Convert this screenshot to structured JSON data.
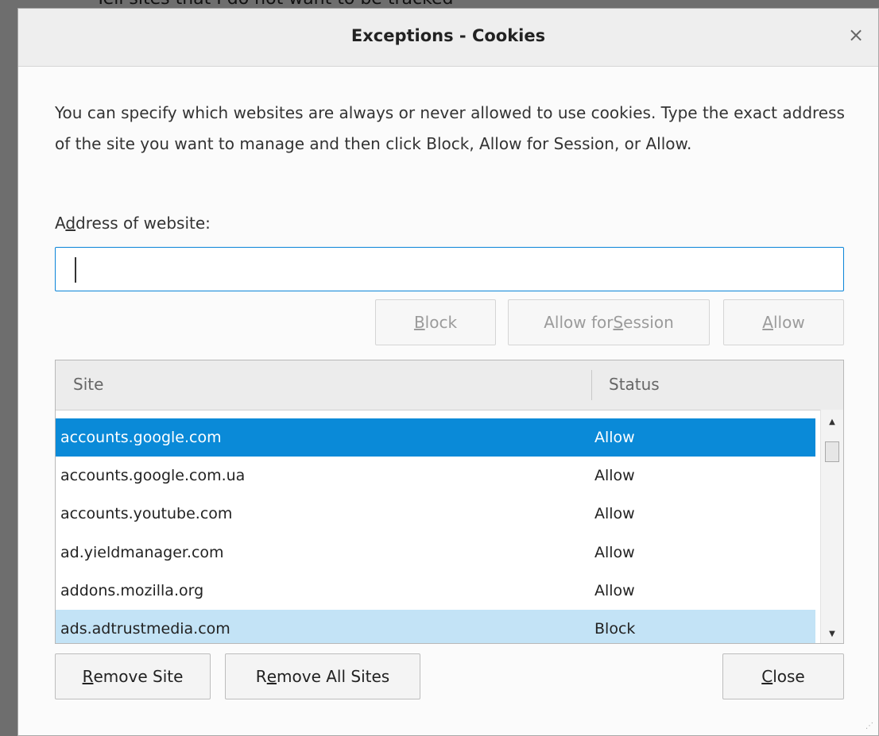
{
  "background_text": "• Tell sites that I do not want to be tracked",
  "dialog": {
    "title": "Exceptions - Cookies",
    "close_glyph": "×",
    "description": "You can specify which websites are always or never allowed to use cookies. Type the exact address of the site you want to manage and then click Block, Allow for Session, or Allow.",
    "address_label_pre": "A",
    "address_label_u": "d",
    "address_label_post": "dress of website:",
    "address_value": "",
    "buttons": {
      "block": {
        "pre": "",
        "u": "B",
        "post": "lock"
      },
      "allow_session": {
        "pre": "Allow for ",
        "u": "S",
        "post": "ession"
      },
      "allow": {
        "pre": "",
        "u": "A",
        "post": "llow"
      }
    },
    "table": {
      "headers": {
        "site": "Site",
        "status": "Status"
      },
      "rows": [
        {
          "site": "accounts.google.com",
          "status": "Allow"
        },
        {
          "site": "accounts.google.com.ua",
          "status": "Allow"
        },
        {
          "site": "accounts.youtube.com",
          "status": "Allow"
        },
        {
          "site": "ad.yieldmanager.com",
          "status": "Allow"
        },
        {
          "site": "addons.mozilla.org",
          "status": "Allow"
        },
        {
          "site": "ads.adtrustmedia.com",
          "status": "Block"
        }
      ]
    },
    "footer": {
      "remove_site": {
        "pre": "",
        "u": "R",
        "post": "emove Site"
      },
      "remove_all": {
        "pre": "R",
        "u": "e",
        "post": "move All Sites"
      },
      "close": {
        "pre": "",
        "u": "C",
        "post": "lose"
      }
    }
  },
  "colors": {
    "selection": "#0a8ad8",
    "selection_secondary": "#c3e3f6",
    "input_focus": "#0a84d8"
  }
}
